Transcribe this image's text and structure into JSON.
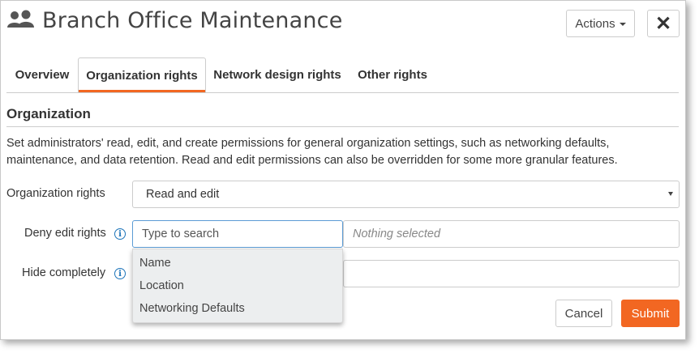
{
  "header": {
    "title": "Branch Office Maintenance",
    "icon": "users-icon",
    "actions_label": "Actions",
    "close_label": "✕"
  },
  "tabs": [
    {
      "label": "Overview",
      "active": false
    },
    {
      "label": "Organization rights",
      "active": true
    },
    {
      "label": "Network design rights",
      "active": false
    },
    {
      "label": "Other rights",
      "active": false
    }
  ],
  "section": {
    "title": "Organization",
    "description": "Set administrators' read, edit, and create permissions for general organization settings, such as networking defaults, maintenance, and data retention. Read and edit permissions can also be overridden for some more granular features."
  },
  "form": {
    "org_rights_label": "Organization rights",
    "org_rights_value": "Read and edit",
    "deny_edit_label": "Deny edit rights",
    "deny_edit_placeholder": "Type to search",
    "nothing_selected": "Nothing selected",
    "hide_completely_label": "Hide completely",
    "dropdown_options": [
      "Name",
      "Location",
      "Networking Defaults"
    ]
  },
  "footer": {
    "cancel_label": "Cancel",
    "submit_label": "Submit"
  },
  "colors": {
    "accent": "#f26722",
    "info": "#1b73b9"
  }
}
